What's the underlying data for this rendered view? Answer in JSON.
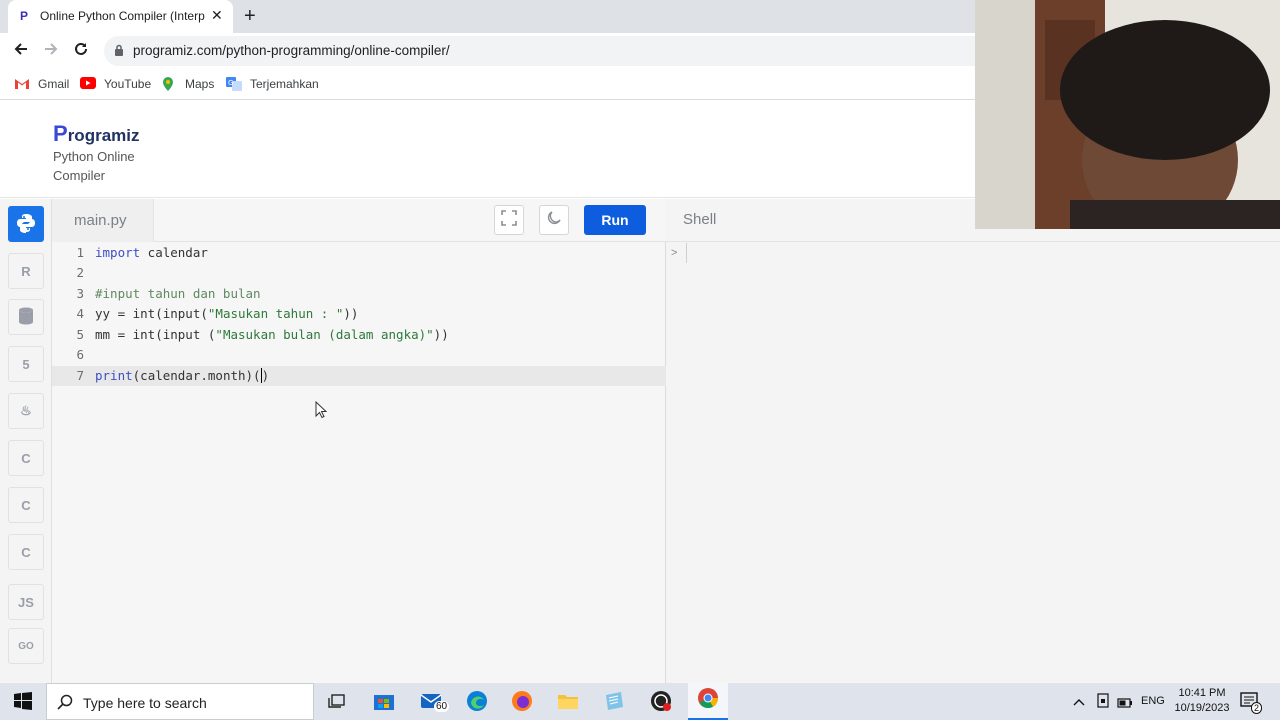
{
  "browser": {
    "tab_title": "Online Python Compiler (Interpr",
    "url": "programiz.com/python-programming/online-compiler/",
    "bookmarks": [
      {
        "label": "Gmail",
        "icon": "gmail-icon"
      },
      {
        "label": "YouTube",
        "icon": "youtube-icon"
      },
      {
        "label": "Maps",
        "icon": "maps-icon"
      },
      {
        "label": "Terjemahkan",
        "icon": "translate-icon"
      }
    ]
  },
  "site": {
    "logo": "Programiz",
    "logo_first": "P",
    "logo_rest": "rogramiz",
    "subtitle": "Python Online Compiler"
  },
  "sidebar": {
    "languages": [
      {
        "name": "python",
        "label": "",
        "icon": "python-icon",
        "active": true
      },
      {
        "name": "r",
        "label": "R",
        "icon": "r-icon",
        "active": false
      },
      {
        "name": "sql",
        "label": "",
        "icon": "database-icon",
        "active": false
      },
      {
        "name": "html",
        "label": "5",
        "icon": "html5-icon",
        "active": false
      },
      {
        "name": "java",
        "label": "",
        "icon": "java-icon",
        "active": false
      },
      {
        "name": "c",
        "label": "C",
        "icon": "c-icon",
        "active": false
      },
      {
        "name": "cpp",
        "label": "C",
        "icon": "cpp-icon",
        "active": false
      },
      {
        "name": "csharp",
        "label": "C",
        "icon": "csharp-icon",
        "active": false
      },
      {
        "name": "js",
        "label": "JS",
        "icon": "js-icon",
        "active": false
      },
      {
        "name": "go",
        "label": "GO",
        "icon": "go-icon",
        "active": false
      }
    ]
  },
  "editor": {
    "filename": "main.py",
    "run_label": "Run",
    "lines": [
      {
        "num": "1",
        "code": "import calendar"
      },
      {
        "num": "2",
        "code": ""
      },
      {
        "num": "3",
        "code": "#input tahun dan bulan"
      },
      {
        "num": "4",
        "code": "yy = int(input(\"Masukan tahun : \"))"
      },
      {
        "num": "5",
        "code": "mm = int(input (\"Masukan bulan (dalam angka)\"))"
      },
      {
        "num": "6",
        "code": ""
      },
      {
        "num": "7",
        "code": "print(calendar.month)()"
      }
    ]
  },
  "shell": {
    "label": "Shell",
    "prompt": ">"
  },
  "taskbar": {
    "search_placeholder": "Type here to search",
    "mail_badge": "60",
    "language": "ENG",
    "time": "10:41 PM",
    "date": "10/19/2023",
    "notification_count": "2"
  }
}
